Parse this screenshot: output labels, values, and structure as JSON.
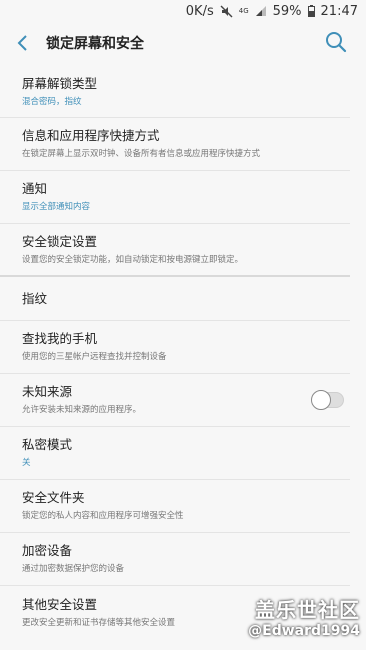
{
  "status_bar": {
    "speed": "0K/s",
    "network": "4G",
    "battery": "59%",
    "time": "21:47",
    "icons": [
      "mute-icon",
      "signal-icon",
      "battery-icon"
    ]
  },
  "header": {
    "title": "锁定屏幕和安全",
    "back_icon": "chevron-left-icon",
    "search_icon": "search-icon",
    "accent_color": "#3f8fb8"
  },
  "items": [
    {
      "label": "屏幕解锁类型",
      "sub": "混合密码，指纹",
      "sub_accent": true
    },
    {
      "label": "信息和应用程序快捷方式",
      "sub": "在锁定屏幕上显示双时钟、设备所有者信息或应用程序快捷方式",
      "sub_accent": false
    },
    {
      "label": "通知",
      "sub": "显示全部通知内容",
      "sub_accent": true
    },
    {
      "label": "安全锁定设置",
      "sub": "设置您的安全锁定功能，如自动锁定和按电源键立即锁定。",
      "sub_accent": false
    },
    {
      "label": "指纹",
      "sub": "",
      "sub_accent": false
    },
    {
      "label": "查找我的手机",
      "sub": "使用您的三星帐户远程查找并控制设备",
      "sub_accent": false
    },
    {
      "label": "未知来源",
      "sub": "允许安装未知来源的应用程序。",
      "sub_accent": false,
      "toggle": false
    },
    {
      "label": "私密模式",
      "sub": "关",
      "sub_accent": true
    },
    {
      "label": "安全文件夹",
      "sub": "锁定您的私人内容和应用程序可增强安全性",
      "sub_accent": false
    },
    {
      "label": "加密设备",
      "sub": "通过加密数据保护您的设备",
      "sub_accent": false
    },
    {
      "label": "其他安全设置",
      "sub": "更改安全更新和证书存储等其他安全设置",
      "sub_accent": false
    }
  ],
  "watermark": {
    "line1": "盖乐世社区",
    "line2": "@Edward1994"
  }
}
